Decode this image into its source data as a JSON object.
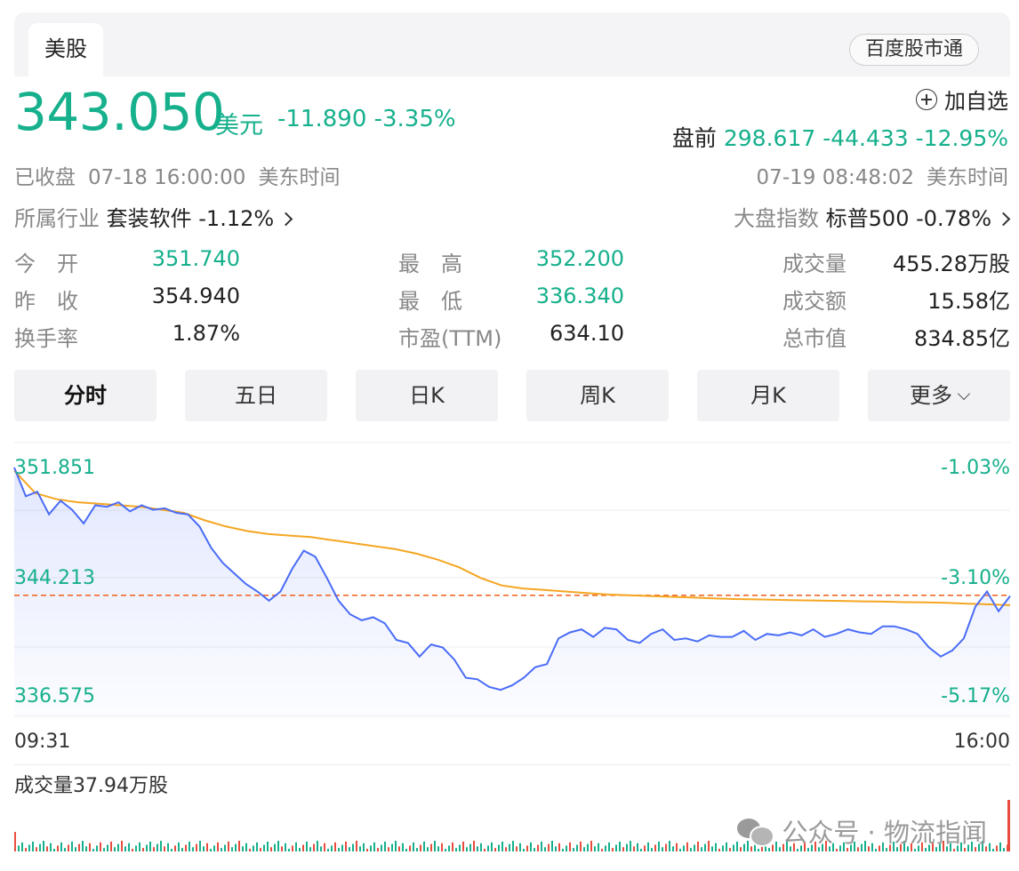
{
  "tabs": {
    "active": "美股",
    "right_button": "百度股市通"
  },
  "quote": {
    "price": "343.050",
    "currency": "美元",
    "change": "-11.890 -3.35%",
    "add_watchlist": "加自选",
    "premarket_label": "盘前",
    "premarket_value": "298.617 -44.433 -12.95%",
    "status": "已收盘",
    "close_time": "07-18 16:00:00",
    "close_tz": "美东时间",
    "pre_time": "07-19 08:48:02",
    "pre_tz": "美东时间",
    "industry_label": "所属行业",
    "industry_value": "套装软件 -1.12%",
    "index_label": "大盘指数",
    "index_value": "标普500 -0.78%"
  },
  "stats": {
    "open_label": "今　开",
    "open": "351.740",
    "prev_label": "昨　收",
    "prev": "354.940",
    "turnover_label": "换手率",
    "turnover": "1.87%",
    "high_label": "最　高",
    "high": "352.200",
    "low_label": "最　低",
    "low": "336.340",
    "pe_label": "市盈(TTM)",
    "pe": "634.10",
    "volume_label": "成交量",
    "volume": "455.28万股",
    "amount_label": "成交额",
    "amount": "15.58亿",
    "mktcap_label": "总市值",
    "mktcap": "834.85亿"
  },
  "periods": [
    "分时",
    "五日",
    "日K",
    "周K",
    "月K",
    "更多"
  ],
  "chart_axis": {
    "y_left": [
      "351.851",
      "344.213",
      "336.575"
    ],
    "y_right": [
      "-1.03%",
      "-3.10%",
      "-5.17%"
    ],
    "x_start": "09:31",
    "x_end": "16:00",
    "volume_label": "成交量37.94万股"
  },
  "watermark": "公众号 · 物流指闻",
  "colors": {
    "up_down_green": "#16b08c",
    "price_line": "#4a6cf7",
    "avg_line": "#f5a623",
    "ref_line": "#f06a2a",
    "volume_up": "#e84c3d"
  },
  "chart_data": {
    "type": "line",
    "x_range": [
      "09:31",
      "16:00"
    ],
    "ylim": [
      336.575,
      351.851
    ],
    "reference_price": 354.94,
    "series": [
      {
        "values": [
          351.5,
          349.6,
          349.9,
          348.4,
          349.3,
          348.7,
          347.8,
          349.0,
          348.9,
          349.2,
          348.6,
          349.0,
          348.7,
          348.8,
          348.5,
          348.4,
          347.6,
          346.2,
          345.2,
          344.5,
          343.8,
          343.3,
          342.7,
          343.3,
          344.8,
          346.0,
          345.6,
          344.2,
          342.7,
          341.8,
          341.4,
          341.6,
          341.2,
          340.1,
          339.9,
          339.0,
          339.8,
          339.6,
          338.8,
          337.6,
          337.5,
          337.0,
          336.8,
          337.1,
          337.6,
          338.3,
          338.5,
          340.2,
          340.6,
          340.8,
          340.3,
          340.9,
          340.8,
          340.1,
          339.9,
          340.5,
          340.8,
          340.1,
          340.2,
          340.0,
          340.4,
          340.3,
          340.3,
          340.7,
          340.1,
          340.5,
          340.4,
          340.6,
          340.4,
          340.8,
          340.3,
          340.5,
          340.8,
          340.6,
          340.5,
          341.0,
          341.0,
          340.8,
          340.5,
          339.6,
          339.0,
          339.4,
          340.2,
          342.3,
          343.3,
          342.0,
          343.0
        ]
      },
      {
        "values": [
          351.3,
          349.8,
          349.4,
          349.2,
          349.1,
          349.0,
          348.9,
          348.7,
          348.5,
          348.0,
          347.6,
          347.3,
          347.1,
          347.0,
          346.9,
          346.7,
          346.5,
          346.3,
          346.1,
          345.8,
          345.4,
          344.9,
          344.2,
          343.7,
          343.5,
          343.4,
          343.3,
          343.2,
          343.1,
          343.05,
          343.0,
          342.95,
          342.9,
          342.85,
          342.8,
          342.78,
          342.75,
          342.72,
          342.7,
          342.68,
          342.65,
          342.63,
          342.6,
          342.58,
          342.55,
          342.5,
          342.45,
          342.4
        ]
      }
    ]
  }
}
